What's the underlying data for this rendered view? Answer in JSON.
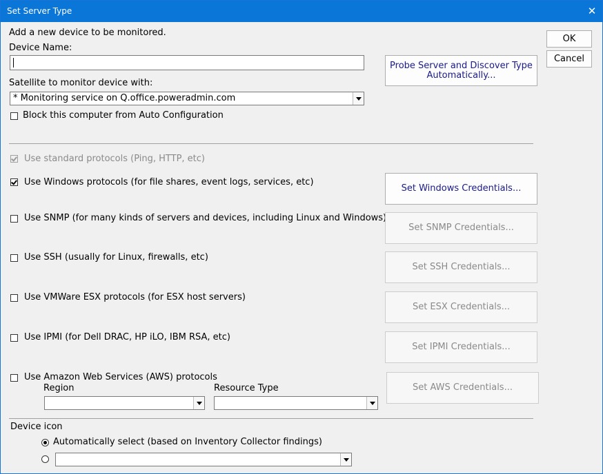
{
  "window": {
    "title": "Set Server Type",
    "close_glyph": "✕"
  },
  "intro": "Add a new device to be monitored.",
  "device_name": {
    "label": "Device Name:",
    "value": ""
  },
  "satellite": {
    "label": "Satellite to monitor device with:",
    "selected": "* Monitoring service on Q.office.poweradmin.com"
  },
  "block_auto_config": {
    "label": "Block this computer from Auto Configuration",
    "checked": false
  },
  "buttons": {
    "ok": "OK",
    "cancel": "Cancel",
    "probe_line1": "Probe Server and Discover Type",
    "probe_line2": "Automatically..."
  },
  "protocols": {
    "standard": {
      "label": "Use standard protocols (Ping, HTTP, etc)",
      "checked": true,
      "enabled": false
    },
    "windows": {
      "label": "Use Windows protocols (for file shares, event logs, services, etc)",
      "checked": true,
      "button": "Set Windows Credentials..."
    },
    "snmp": {
      "label": "Use SNMP (for many kinds of servers and devices, including Linux and Windows)",
      "checked": false,
      "button": "Set SNMP Credentials..."
    },
    "ssh": {
      "label": "Use SSH (usually for Linux, firewalls, etc)",
      "checked": false,
      "button": "Set SSH Credentials..."
    },
    "esx": {
      "label": "Use VMWare ESX protocols (for ESX host servers)",
      "checked": false,
      "button": "Set ESX Credentials..."
    },
    "ipmi": {
      "label": "Use IPMI (for Dell DRAC, HP iLO, IBM RSA, etc)",
      "checked": false,
      "button": "Set IPMI Credentials..."
    },
    "aws": {
      "label": "Use Amazon Web Services (AWS) protocols",
      "checked": false,
      "button": "Set AWS Credentials...",
      "region_label": "Region",
      "region_value": "",
      "resource_label": "Resource Type",
      "resource_value": ""
    }
  },
  "device_icon": {
    "label": "Device icon",
    "auto_label": "Automatically select (based on Inventory Collector findings)",
    "auto_selected": true,
    "manual_value": ""
  },
  "colors": {
    "titlebar": "#0a76d8",
    "window_bg": "#f0f0f0",
    "primary_text": "#1a1a8c",
    "disabled_text": "#8a8a8a"
  }
}
